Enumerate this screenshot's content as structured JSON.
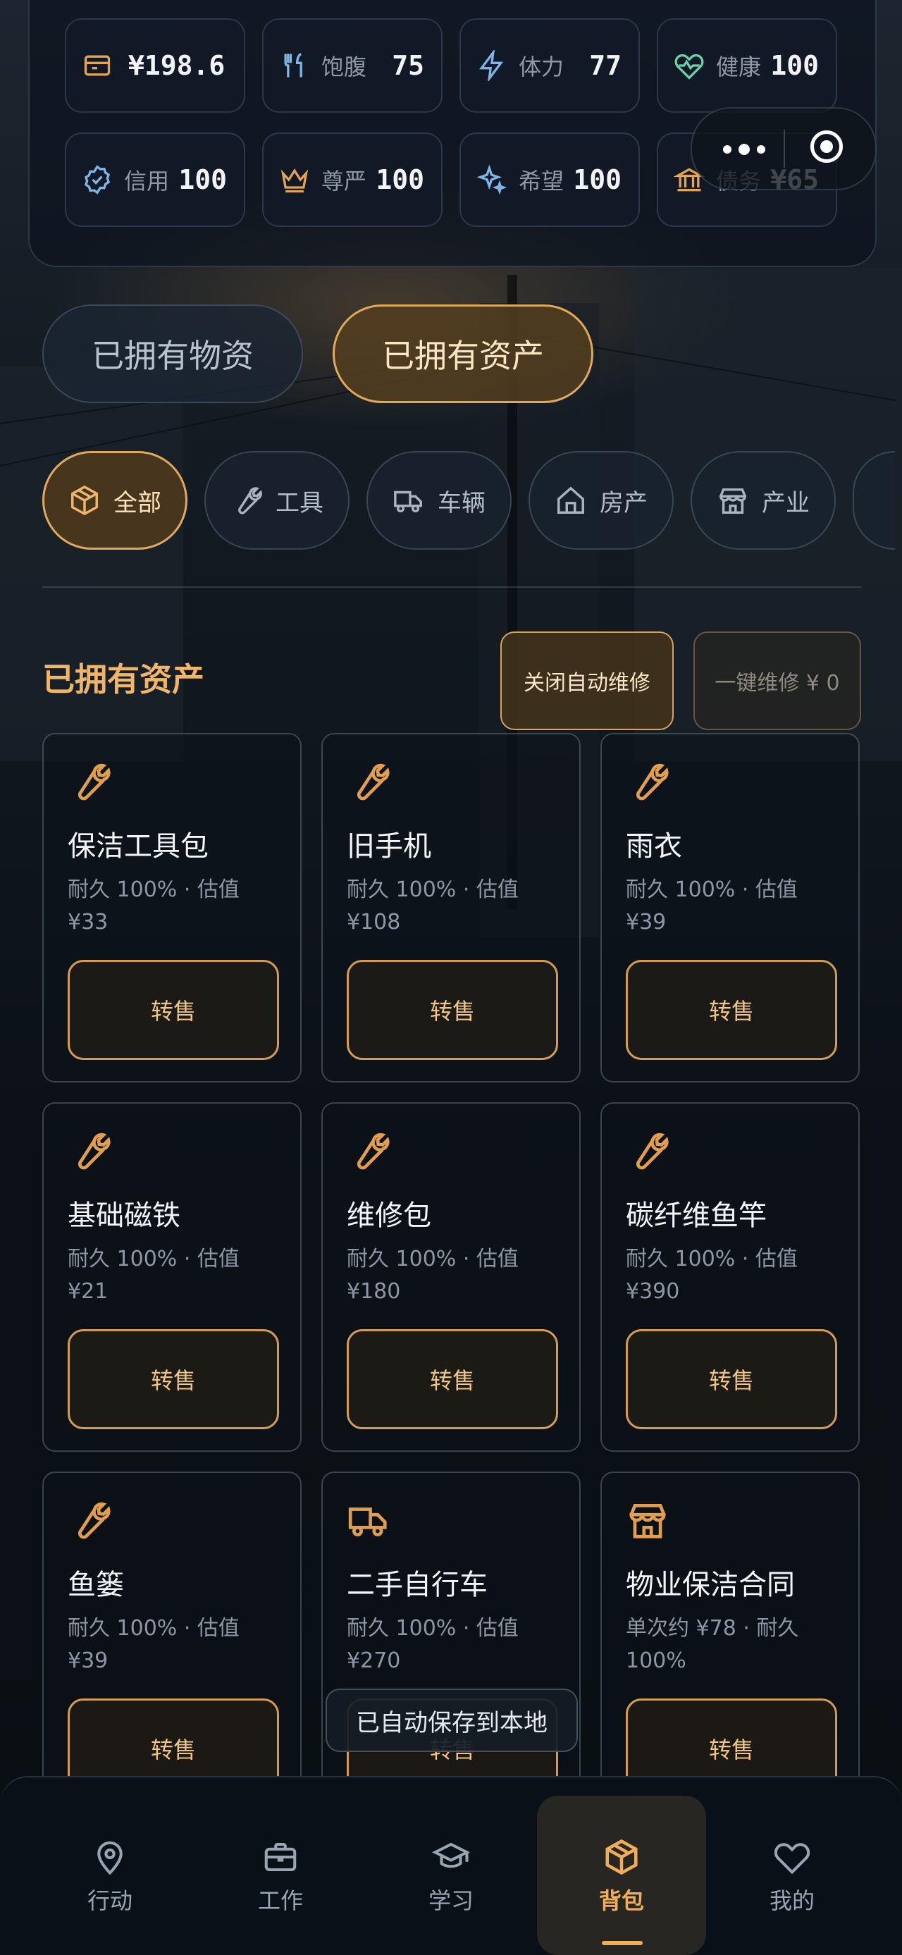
{
  "stats": [
    {
      "icon": "wallet-icon",
      "label": "",
      "value": "¥198.6",
      "color": "#e4a454"
    },
    {
      "icon": "fork-knife-icon",
      "label": "饱腹",
      "value": "75",
      "color": "#7fb6e6"
    },
    {
      "icon": "lightning-icon",
      "label": "体力",
      "value": "77",
      "color": "#7fb6e6"
    },
    {
      "icon": "heart-pulse-icon",
      "label": "健康",
      "value": "100",
      "color": "#6fd0a8"
    },
    {
      "icon": "badge-check-icon",
      "label": "信用",
      "value": "100",
      "color": "#7fb6e6"
    },
    {
      "icon": "crown-icon",
      "label": "尊严",
      "value": "100",
      "color": "#e4a454"
    },
    {
      "icon": "sparkles-icon",
      "label": "希望",
      "value": "100",
      "color": "#7fb6e6"
    },
    {
      "icon": "bank-icon",
      "label": "债务",
      "value": "¥65",
      "color": "#e4a454"
    }
  ],
  "main_tabs": {
    "materials": "已拥有物资",
    "assets": "已拥有资产"
  },
  "filters": [
    {
      "label": "全部",
      "icon": "box-icon"
    },
    {
      "label": "工具",
      "icon": "wrench-icon"
    },
    {
      "label": "车辆",
      "icon": "truck-icon"
    },
    {
      "label": "房产",
      "icon": "house-icon"
    },
    {
      "label": "产业",
      "icon": "store-icon"
    }
  ],
  "section": {
    "title": "已拥有资产",
    "auto_repair": "关闭自动维修",
    "repair_all": "一键维修 ¥ 0"
  },
  "assets": [
    {
      "name": "保洁工具包",
      "meta": "耐久 100% · 估值 ¥33",
      "action": "转售",
      "icon": "wrench-icon"
    },
    {
      "name": "旧手机",
      "meta": "耐久 100% · 估值 ¥108",
      "action": "转售",
      "icon": "wrench-icon"
    },
    {
      "name": "雨衣",
      "meta": "耐久 100% · 估值 ¥39",
      "action": "转售",
      "icon": "wrench-icon"
    },
    {
      "name": "基础磁铁",
      "meta": "耐久 100% · 估值 ¥21",
      "action": "转售",
      "icon": "wrench-icon"
    },
    {
      "name": "维修包",
      "meta": "耐久 100% · 估值 ¥180",
      "action": "转售",
      "icon": "wrench-icon"
    },
    {
      "name": "碳纤维鱼竿",
      "meta": "耐久 100% · 估值 ¥390",
      "action": "转售",
      "icon": "wrench-icon"
    },
    {
      "name": "鱼篓",
      "meta": "耐久 100% · 估值 ¥39",
      "action": "转售",
      "icon": "wrench-icon"
    },
    {
      "name": "二手自行车",
      "meta": "耐久 100% · 估值 ¥270",
      "action": "转售",
      "icon": "truck-icon"
    },
    {
      "name": "物业保洁合同",
      "meta": "单次约 ¥78 · 耐久 100%",
      "action": "转售",
      "icon": "store-icon"
    }
  ],
  "toast": "已自动保存到本地",
  "nav": [
    {
      "label": "行动",
      "icon": "map-pin-icon"
    },
    {
      "label": "工作",
      "icon": "briefcase-icon"
    },
    {
      "label": "学习",
      "icon": "graduation-cap-icon"
    },
    {
      "label": "背包",
      "icon": "box-icon"
    },
    {
      "label": "我的",
      "icon": "heart-icon"
    }
  ],
  "colors": {
    "accent": "#e8a958",
    "panel": "#101a26",
    "muted": "#8d97a5"
  }
}
